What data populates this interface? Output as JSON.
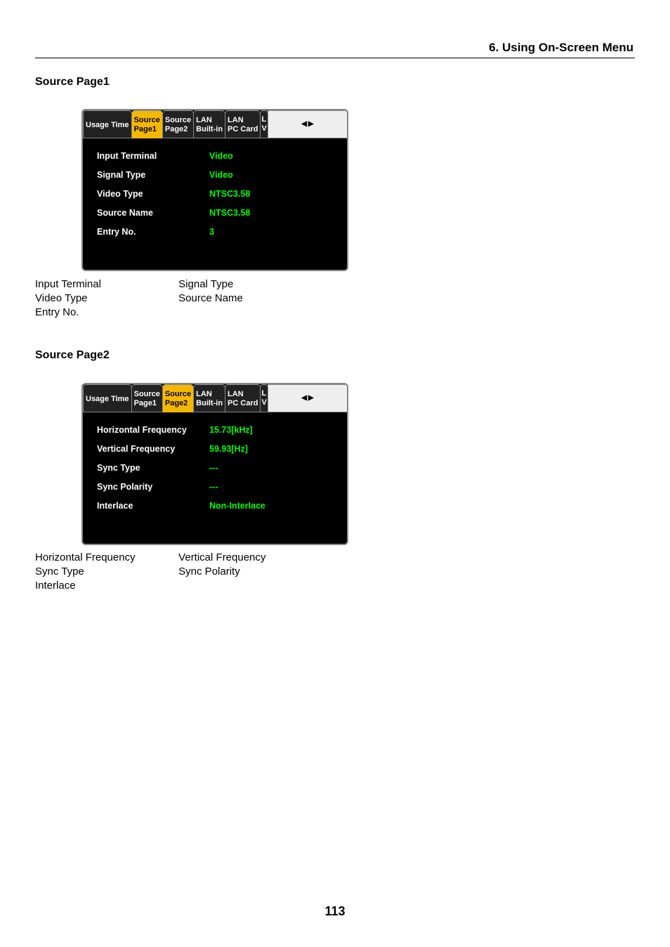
{
  "chapter": "6. Using On-Screen Menu",
  "page_number": "113",
  "section1": {
    "heading": "Source Page1",
    "tabs": [
      {
        "line1": "Usage Time",
        "line2": "",
        "selected": false
      },
      {
        "line1": "Source",
        "line2": "Page1",
        "selected": true
      },
      {
        "line1": "Source",
        "line2": "Page2",
        "selected": false
      },
      {
        "line1": "LAN",
        "line2": "Built-in",
        "selected": false
      },
      {
        "line1": "LAN",
        "line2": "PC Card",
        "selected": false
      },
      {
        "line1": "L",
        "line2": "V",
        "selected": false
      }
    ],
    "rows": [
      {
        "label": "Input Terminal",
        "value": "Video"
      },
      {
        "label": "Signal Type",
        "value": "Video"
      },
      {
        "label": "Video Type",
        "value": "NTSC3.58"
      },
      {
        "label": "Source Name",
        "value": "NTSC3.58"
      },
      {
        "label": "Entry No.",
        "value": "3"
      }
    ],
    "items": {
      "c1r1": "Input Terminal",
      "c2r1": "Signal Type",
      "c1r2": "Video Type",
      "c2r2": "Source Name",
      "c1r3": "Entry No."
    }
  },
  "section2": {
    "heading": "Source Page2",
    "tabs": [
      {
        "line1": "Usage Time",
        "line2": "",
        "selected": false
      },
      {
        "line1": "Source",
        "line2": "Page1",
        "selected": false
      },
      {
        "line1": "Source",
        "line2": "Page2",
        "selected": true
      },
      {
        "line1": "LAN",
        "line2": "Built-in",
        "selected": false
      },
      {
        "line1": "LAN",
        "line2": "PC Card",
        "selected": false
      },
      {
        "line1": "L",
        "line2": "V",
        "selected": false
      }
    ],
    "rows": [
      {
        "label": "Horizontal Frequency",
        "value": "15.73[kHz]"
      },
      {
        "label": "Vertical Frequency",
        "value": "59.93[Hz]"
      },
      {
        "label": "Sync Type",
        "value": "---"
      },
      {
        "label": "Sync Polarity",
        "value": "---"
      },
      {
        "label": "Interlace",
        "value": "Non-Interlace"
      }
    ],
    "items": {
      "c1r1": "Horizontal Frequency",
      "c2r1": "Vertical Frequency",
      "c1r2": "Sync Type",
      "c2r2": "Sync Polarity",
      "c1r3": "Interlace"
    }
  }
}
